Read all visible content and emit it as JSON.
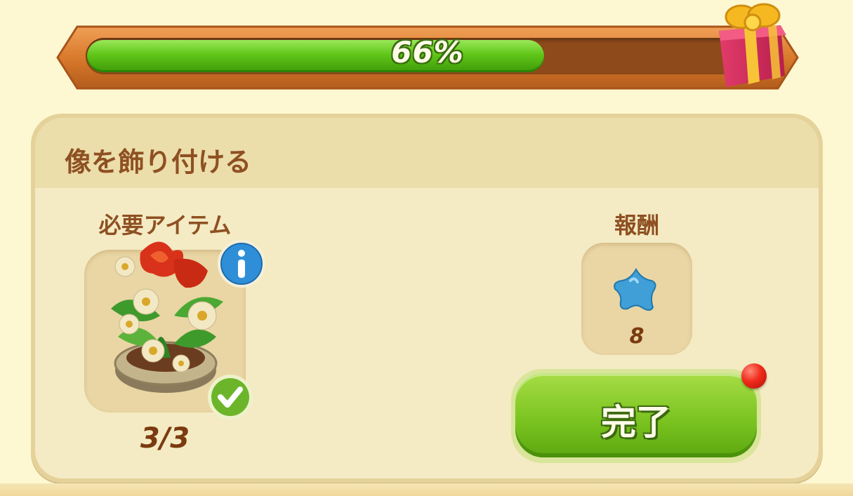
{
  "progress": {
    "percent_label": "66%",
    "value": 0.66
  },
  "quest": {
    "title": "像を飾り付ける"
  },
  "required": {
    "label": "必要アイテム",
    "count": "3/3",
    "item_icon": "flower-pot-icon"
  },
  "reward": {
    "label": "報酬",
    "amount": "8",
    "icon": "blue-star-icon"
  },
  "complete_button": {
    "label": "完了"
  },
  "colors": {
    "background": "#fdf8d2",
    "progress_fill": "#5fc618",
    "title_text": "#8e5022",
    "button_green": "#7cc421",
    "notification_red": "#f02a1a"
  }
}
